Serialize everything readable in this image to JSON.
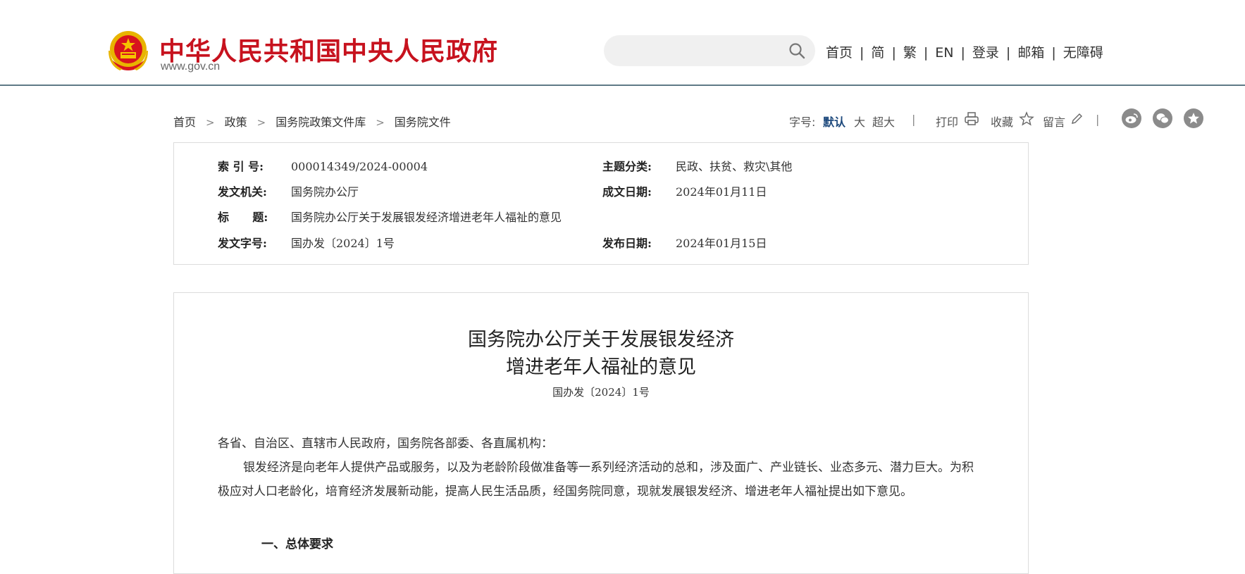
{
  "header": {
    "site_title": "中华人民共和国中央人民政府",
    "site_url": "www.gov.cn",
    "search": {
      "placeholder": ""
    },
    "nav": [
      "首页",
      "简",
      "繁",
      "EN",
      "登录",
      "邮箱",
      "无障碍"
    ]
  },
  "breadcrumb": [
    "首页",
    "政策",
    "国务院政策文件库",
    "国务院文件"
  ],
  "tools": {
    "font_size_label": "字号:",
    "font_default": "默认",
    "font_large": "大",
    "font_xlarge": "超大",
    "print_label": "打印",
    "favorite_label": "收藏",
    "comment_label": "留言"
  },
  "meta": {
    "index_label": "索  引  号:",
    "index_value": "000014349/2024-00004",
    "topic_label": "主题分类:",
    "topic_value": "民政、扶贫、救灾\\其他",
    "issuer_label": "发文机关:",
    "issuer_value": "国务院办公厅",
    "created_label": "成文日期:",
    "created_value": "2024年01月11日",
    "title_label": "标      题:",
    "title_value": "国务院办公厅关于发展银发经济增进老年人福祉的意见",
    "docno_label": "发文字号:",
    "docno_value": "国办发〔2024〕1号",
    "published_label": "发布日期:",
    "published_value": "2024年01月15日"
  },
  "article": {
    "title_line1": "国务院办公厅关于发展银发经济",
    "title_line2": "增进老年人福祉的意见",
    "doc_number": "国办发〔2024〕1号",
    "salutation": "各省、自治区、直辖市人民政府，国务院各部委、各直属机构：",
    "paragraph1": "银发经济是向老年人提供产品或服务，以及为老龄阶段做准备等一系列经济活动的总和，涉及面广、产业链长、业态多元、潜力巨大。为积极应对人口老龄化，培育经济发展新动能，提高人民生活品质，经国务院同意，现就发展银发经济、增进老年人福祉提出如下意见。",
    "section1": "一、总体要求"
  },
  "colors": {
    "brand_red": "#c7121e",
    "header_line": "#5f7a86",
    "active_blue": "#1e4a7d"
  },
  "icons": [
    "national-emblem",
    "search-icon",
    "printer-icon",
    "star-icon",
    "pencil-icon",
    "weibo-icon",
    "wechat-icon",
    "favorite-star-icon"
  ]
}
